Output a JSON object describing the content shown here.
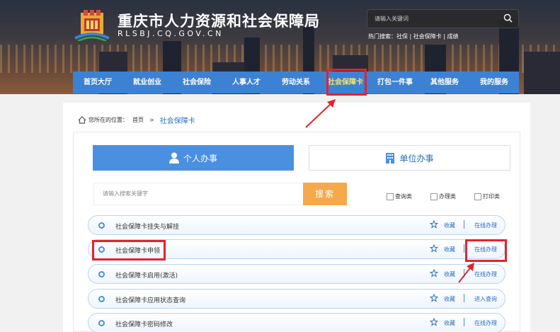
{
  "header": {
    "site_title": "重庆市人力资源和社会保障局",
    "site_domain": "RLSBJ.CQ.GOV.CN",
    "search_placeholder": "请输入关键词",
    "hot_search": "热门搜索：社保 | 社会保障卡 | 成绩"
  },
  "nav": {
    "items": [
      {
        "label": "首页大厅"
      },
      {
        "label": "就业创业"
      },
      {
        "label": "社会保险"
      },
      {
        "label": "人事人才"
      },
      {
        "label": "劳动关系"
      },
      {
        "label": "社会保障卡",
        "active": true
      },
      {
        "label": "打包一件事"
      },
      {
        "label": "其他服务"
      },
      {
        "label": "我的服务"
      }
    ]
  },
  "breadcrumb": {
    "prefix": "您所在的位置：",
    "home": "首页",
    "sep": ">",
    "current": "社会保障卡"
  },
  "tabs": {
    "personal": "个人办事",
    "unit": "单位办事"
  },
  "search": {
    "placeholder": "请输入搜索关键字",
    "button": "搜索"
  },
  "filters": [
    "查询类",
    "办理类",
    "打印类"
  ],
  "services": [
    {
      "name": "社会保障卡挂失与解挂",
      "fav": "收藏",
      "action": "在线办理"
    },
    {
      "name": "社会保障卡申领",
      "fav": "收藏",
      "action": "在线办理"
    },
    {
      "name": "社会保障卡启用(激活)",
      "fav": "收藏",
      "action": "在线办理"
    },
    {
      "name": "社会保障卡应用状态查询",
      "fav": "收藏",
      "action": "进入查询"
    },
    {
      "name": "社会保障卡密码修改",
      "fav": "收藏",
      "action": "在线办理"
    }
  ],
  "colors": {
    "accent": "#3c82d4",
    "highlight": "#e3232b",
    "button": "#f5a94a"
  }
}
